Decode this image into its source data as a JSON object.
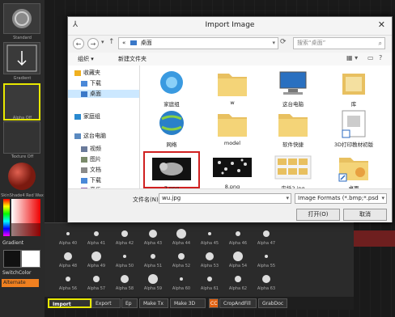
{
  "left_panel": {
    "standard_label": "Standard",
    "gradient_tile_label": "Gradient",
    "alpha_off_label": "Alpha Off",
    "texture_off_label": "Texture Off",
    "material_label": "SkinShade4 Red Wax",
    "gradient_label": "Gradient",
    "switch_color_label": "SwitchColor",
    "alternate_label": "Alternate"
  },
  "dialog": {
    "title": "Import Image",
    "address": "桌面",
    "address_prefix": "«",
    "search_placeholder": "搜索“桌面”",
    "organize_label": "组织 ▾",
    "new_folder_label": "新建文件夹",
    "sidebar": [
      {
        "label": "收藏夹",
        "icon": "star-icon"
      },
      {
        "label": "下载",
        "icon": "download-folder-icon"
      },
      {
        "label": "桌面",
        "icon": "desktop-icon",
        "selected": true
      },
      {
        "label": "家庭组",
        "icon": "homegroup-icon"
      },
      {
        "label": "这台电脑",
        "icon": "computer-icon"
      },
      {
        "label": "视频",
        "icon": "video-folder-icon"
      },
      {
        "label": "图片",
        "icon": "picture-folder-icon"
      },
      {
        "label": "文档",
        "icon": "document-folder-icon"
      },
      {
        "label": "下载",
        "icon": "download-folder-icon"
      },
      {
        "label": "音乐",
        "icon": "music-folder-icon"
      }
    ],
    "files": [
      {
        "name": "家庭组",
        "kind": "homegroup"
      },
      {
        "name": "w",
        "kind": "folder"
      },
      {
        "name": "这台电脑",
        "kind": "computer"
      },
      {
        "name": "库",
        "kind": "library"
      },
      {
        "name": "网络",
        "kind": "network"
      },
      {
        "name": "model",
        "kind": "folder"
      },
      {
        "name": "软件快捷",
        "kind": "folder"
      },
      {
        "name": "3D打印教材初版",
        "kind": "shortcut"
      },
      {
        "name": "7.png",
        "kind": "png-lion",
        "selected": true
      },
      {
        "name": "8.png",
        "kind": "png-dots"
      },
      {
        "name": "内托2.jpg",
        "kind": "jpg-grid"
      },
      {
        "name": "桌面",
        "kind": "folder-shortcut"
      }
    ],
    "filename_label": "文件名(N):",
    "filename_value": "wu.jpg",
    "filetype_value": "Image Formats (*.bmp;*.psd",
    "open_label": "打开(O)",
    "cancel_label": "取消"
  },
  "alpha_grid": [
    [
      "Alpha 40",
      "Alpha 41",
      "Alpha 42",
      "Alpha 43",
      "Alpha 44",
      "Alpha 45",
      "Alpha 46",
      "Alpha 47"
    ],
    [
      "Alpha 48",
      "Alpha 49",
      "Alpha 50",
      "Alpha 51",
      "Alpha 52",
      "Alpha 53",
      "Alpha 54",
      "Alpha 55"
    ],
    [
      "Alpha 56",
      "Alpha 57",
      "Alpha 58",
      "Alpha 59",
      "Alpha 60",
      "Alpha 61",
      "Alpha 62",
      "Alpha 63"
    ]
  ],
  "bottom_bar": {
    "import": "Import",
    "export": "Export",
    "ep": "Ep",
    "make_tx": "Make Tx",
    "make_3d": "Make 3D",
    "cc": "CC",
    "crop_and_fill": "CropAndFill",
    "grab_doc": "GrabDoc"
  },
  "colors": {
    "highlight": "#e8e800",
    "selection_red": "#d02020",
    "accent_orange": "#f08020"
  }
}
